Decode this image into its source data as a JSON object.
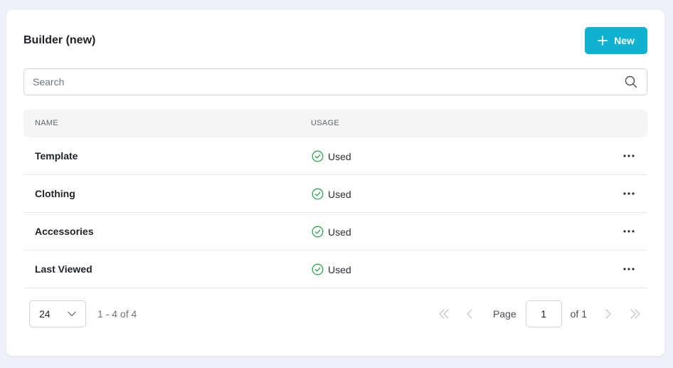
{
  "header": {
    "title": "Builder (new)",
    "new_button_label": "New"
  },
  "search": {
    "placeholder": "Search",
    "value": ""
  },
  "table": {
    "columns": [
      "NAME",
      "USAGE"
    ],
    "rows": [
      {
        "name": "Template",
        "usage": "Used"
      },
      {
        "name": "Clothing",
        "usage": "Used"
      },
      {
        "name": "Accessories",
        "usage": "Used"
      },
      {
        "name": "Last Viewed",
        "usage": "Used"
      }
    ]
  },
  "pagination": {
    "page_size": "24",
    "range_text": "1 - 4 of 4",
    "page_label": "Page",
    "current_page": "1",
    "of_label": "of 1"
  },
  "colors": {
    "accent": "#0fb3cf",
    "success": "#2ea44f",
    "background": "#eef1f7"
  }
}
